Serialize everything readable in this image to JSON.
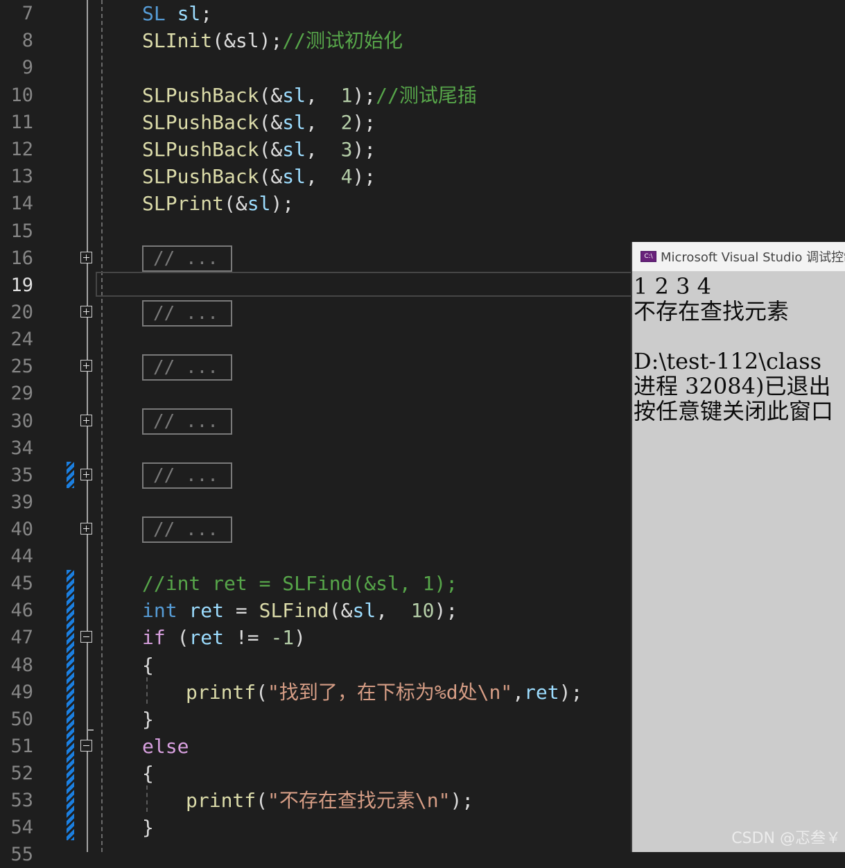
{
  "editor": {
    "line_numbers": [
      "7",
      "8",
      "9",
      "10",
      "11",
      "12",
      "13",
      "14",
      "15",
      "16",
      "19",
      "20",
      "24",
      "25",
      "29",
      "30",
      "34",
      "35",
      "39",
      "40",
      "44",
      "45",
      "46",
      "47",
      "48",
      "49",
      "50",
      "51",
      "52",
      "53",
      "54",
      "55"
    ],
    "current_line": "19",
    "collapsed_placeholder": "// ...",
    "lines": {
      "l7": {
        "type": "SL",
        "space": " ",
        "var": "sl",
        "semi": ";"
      },
      "l8": {
        "fn": "SLInit",
        "args": "(&sl);",
        "comment": "//测试初始化"
      },
      "l10": {
        "fn": "SLPushBack",
        "open": "(&",
        "var": "sl",
        "mid": ",  ",
        "num": "1",
        "close": ");",
        "comment": "//测试尾插"
      },
      "l11": {
        "fn": "SLPushBack",
        "open": "(&",
        "var": "sl",
        "mid": ",  ",
        "num": "2",
        "close": ");"
      },
      "l12": {
        "fn": "SLPushBack",
        "open": "(&",
        "var": "sl",
        "mid": ",  ",
        "num": "3",
        "close": ");"
      },
      "l13": {
        "fn": "SLPushBack",
        "open": "(&",
        "var": "sl",
        "mid": ",  ",
        "num": "4",
        "close": ");"
      },
      "l14": {
        "fn": "SLPrint",
        "open": "(&",
        "var": "sl",
        "close": ");"
      },
      "l45": {
        "comment": "//int ret = SLFind(&sl, 1);"
      },
      "l46": {
        "kw": "int",
        "var": " ret",
        "op": " = ",
        "fn": "SLFind",
        "open": "(&",
        "var2": "sl",
        "mid": ",  ",
        "num": "10",
        "close": ");"
      },
      "l47": {
        "kw": "if",
        "open": " (",
        "var": "ret",
        "op": " != ",
        "num": "-1",
        "close": ")"
      },
      "l48": {
        "text": "{"
      },
      "l49": {
        "fn": "printf",
        "open": "(",
        "str": "\"找到了，在下标为%d处\\n\"",
        "comma": ",",
        "var": "ret",
        "close": ");"
      },
      "l50": {
        "text": "}"
      },
      "l51": {
        "kw": "else"
      },
      "l52": {
        "text": "{"
      },
      "l53": {
        "fn": "printf",
        "open": "(",
        "str": "\"不存在查找元素\\n\"",
        "close": ");"
      },
      "l54": {
        "text": "}"
      }
    }
  },
  "console": {
    "title": "Microsoft Visual Studio 调试控制台",
    "icon_label": "C:\\",
    "lines": [
      "1 2 3 4",
      "不存在查找元素",
      "",
      "D:\\test-112\\class",
      "进程 32084)已退出",
      "按任意键关闭此窗口"
    ]
  },
  "watermark": "CSDN @忑叁￥",
  "colors": {
    "background": "#1e1e1e",
    "keyword": "#569cd6",
    "control": "#d8a0df",
    "function": "#dcdcaa",
    "variable": "#9cdcfe",
    "number": "#b5cea8",
    "string": "#d69d85",
    "comment": "#57a64a",
    "change_bar": "#1b7fe0"
  }
}
